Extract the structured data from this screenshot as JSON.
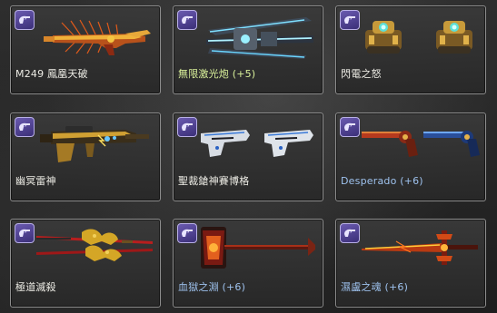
{
  "colors": {
    "normal": "#ecebe4",
    "green": "#d9f09a",
    "blue": "#9ec2ee",
    "border": "#8d8d8d",
    "badge": "#4c3f95"
  },
  "items": [
    {
      "name": "M249 鳳凰天破",
      "color": "normal",
      "icon": "phoenix-machinegun-icon"
    },
    {
      "name": "無限激光炮 (+5)",
      "color": "green",
      "icon": "laser-cannon-icon"
    },
    {
      "name": "閃電之怒",
      "color": "normal",
      "icon": "lightning-turret-icon"
    },
    {
      "name": "幽冥雷神",
      "color": "normal",
      "icon": "thunder-rifle-icon"
    },
    {
      "name": "聖裁鎗神賽博格",
      "color": "normal",
      "icon": "cyborg-pistol-icon"
    },
    {
      "name": "Desperado (+6)",
      "color": "blue",
      "icon": "desperado-revolver-icon"
    },
    {
      "name": "極道滅殺",
      "color": "normal",
      "icon": "dragon-katana-icon"
    },
    {
      "name": "血獄之淵 (+6)",
      "color": "blue",
      "icon": "blood-hammer-icon"
    },
    {
      "name": "濕盧之魂 (+6)",
      "color": "blue",
      "icon": "flame-sword-icon"
    }
  ]
}
